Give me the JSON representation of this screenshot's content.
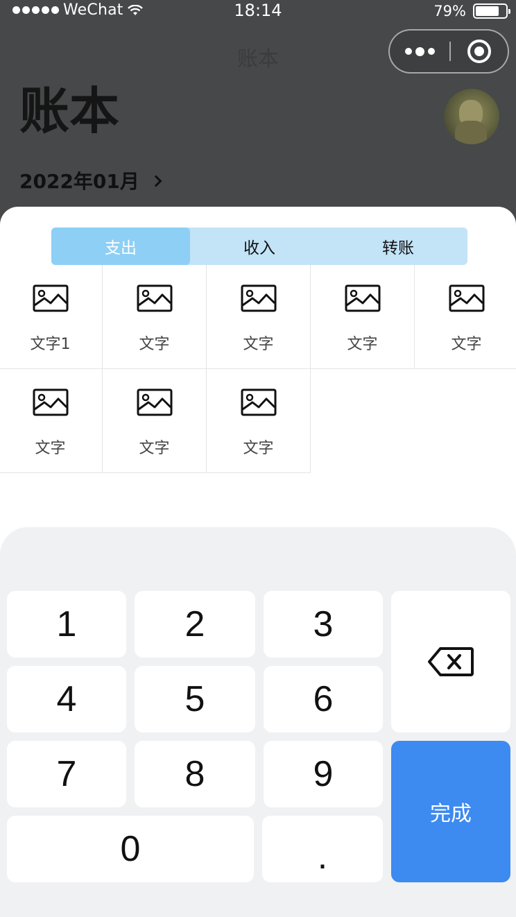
{
  "status_bar": {
    "carrier": "WeChat",
    "time": "18:14",
    "battery": "79%",
    "battery_level": 0.79
  },
  "nav": {
    "title": "账本"
  },
  "header": {
    "title": "账本",
    "month": "2022年01月"
  },
  "tabs": [
    {
      "label": "支出",
      "active": true
    },
    {
      "label": "收入",
      "active": false
    },
    {
      "label": "转账",
      "active": false
    }
  ],
  "categories": [
    {
      "label": "文字1",
      "icon": "image-icon"
    },
    {
      "label": "文字",
      "icon": "image-icon"
    },
    {
      "label": "文字",
      "icon": "image-icon"
    },
    {
      "label": "文字",
      "icon": "image-icon"
    },
    {
      "label": "文字",
      "icon": "image-icon"
    },
    {
      "label": "文字",
      "icon": "image-icon"
    },
    {
      "label": "文字",
      "icon": "image-icon"
    },
    {
      "label": "文字",
      "icon": "image-icon"
    }
  ],
  "keypad": {
    "keys": [
      "1",
      "2",
      "3",
      "4",
      "5",
      "6",
      "7",
      "8",
      "9",
      "0",
      "."
    ],
    "backspace_icon": "backspace-icon",
    "done_label": "完成"
  },
  "colors": {
    "tab_bg": "#c3e3f7",
    "tab_active": "#8ecff5",
    "done_button": "#3d8af0",
    "keypad_bg": "#f0f1f3"
  }
}
